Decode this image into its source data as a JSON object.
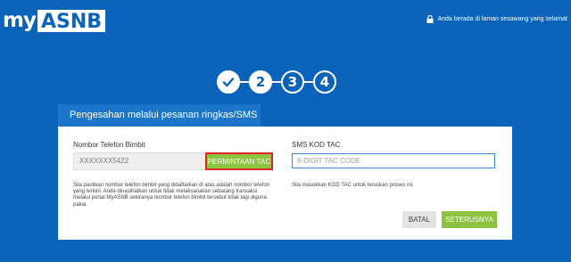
{
  "header": {
    "logo_my": "my",
    "logo_brand": "ASNB",
    "secure_notice": "Anda berada di laman sesawang yang selamat"
  },
  "steps": [
    {
      "label": "✓",
      "state": "done"
    },
    {
      "label": "2",
      "state": "active"
    },
    {
      "label": "3",
      "state": "pending"
    },
    {
      "label": "4",
      "state": "pending"
    }
  ],
  "card": {
    "title": "Pengesahan melalui pesanan ringkas/SMS",
    "phone": {
      "label": "Nombor Telefon Bimbit",
      "value": "XXXXXXX5422",
      "request_button": "PERMINTAAN TAC",
      "help": "Sila pastikan nombor telefon bimbit yang didaftarkan di atas adalah nombor telefon yang terkini. Anda dinasihatkan untuk tidak melaksanakan sebarang transaksi melalui portal MyASNB sekiranya nombor telefon bimbit tersebut tidak lagi diguna pakai."
    },
    "tac": {
      "label": "SMS KOD TAC",
      "placeholder": "6-DIGIT TAC CODE",
      "help": "Sila masukkan KOD TAC untuk teruskan proses ini."
    },
    "buttons": {
      "cancel": "BATAL",
      "next": "SETERUSNYA"
    }
  },
  "colors": {
    "background": "#0b64b9",
    "accent_green": "#8cc43f",
    "highlight_red": "#e0242a"
  }
}
